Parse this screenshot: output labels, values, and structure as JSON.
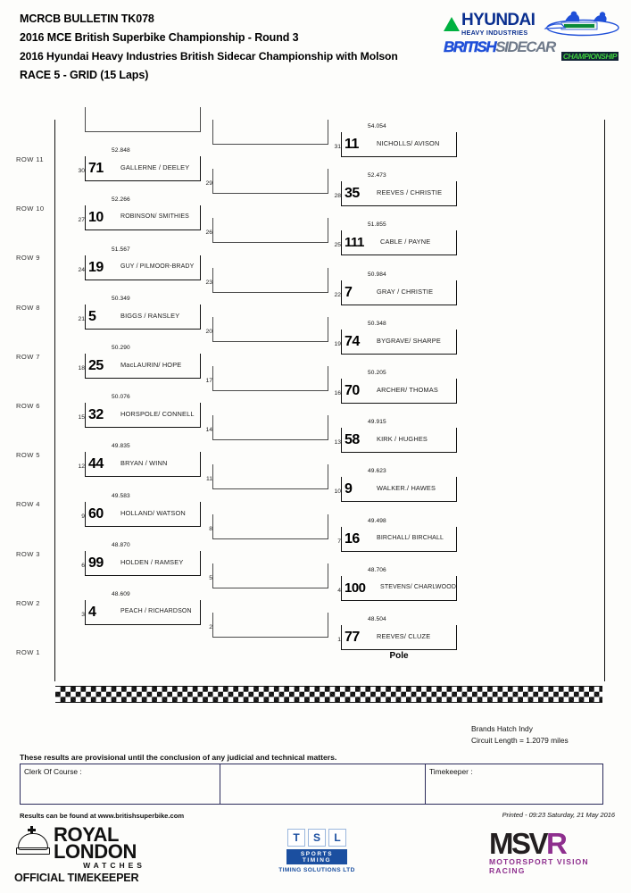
{
  "header": {
    "bulletin": "MCRCB BULLETIN TK078",
    "championship": "2016 MCE British Superbike Championship - Round 3",
    "series": "2016 Hyundai Heavy Industries British Sidecar Championship with Molson",
    "race": "RACE 5 - GRID (15 Laps)"
  },
  "logo": {
    "hyundai_main": "HYUNDAI",
    "hyundai_sub": "HEAVY INDUSTRIES",
    "british": "BRITISH",
    "sidecar": "SIDECAR",
    "championship": "CHAMPIONSHIP"
  },
  "grid": {
    "pole_label": "Pole",
    "rows": [
      {
        "label": "ROW 11",
        "slots": [
          {
            "column": "left",
            "pos": "",
            "time": "",
            "number": "",
            "name": ""
          },
          {
            "column": "middle",
            "pos": "",
            "time": "",
            "number": "",
            "name": ""
          },
          {
            "column": "right",
            "pos": "31",
            "time": "54.054",
            "number": "11",
            "name": "NICHOLLS/ AVISON"
          }
        ]
      },
      {
        "label": "ROW 10",
        "slots": [
          {
            "column": "left",
            "pos": "30",
            "time": "52.848",
            "number": "71",
            "name": "GALLERNE / DEELEY"
          },
          {
            "column": "middle",
            "pos": "29",
            "time": "",
            "number": "",
            "name": ""
          },
          {
            "column": "right",
            "pos": "28",
            "time": "52.473",
            "number": "35",
            "name": "REEVES / CHRISTIE"
          }
        ]
      },
      {
        "label": "ROW 9",
        "slots": [
          {
            "column": "left",
            "pos": "27",
            "time": "52.266",
            "number": "10",
            "name": "ROBINSON/ SMITHIES"
          },
          {
            "column": "middle",
            "pos": "26",
            "time": "",
            "number": "",
            "name": ""
          },
          {
            "column": "right",
            "pos": "25",
            "time": "51.855",
            "number": "111",
            "name": "CABLE / PAYNE"
          }
        ]
      },
      {
        "label": "ROW 8",
        "slots": [
          {
            "column": "left",
            "pos": "24",
            "time": "51.567",
            "number": "19",
            "name": "GUY / PILMOOR-BRADY"
          },
          {
            "column": "middle",
            "pos": "23",
            "time": "",
            "number": "",
            "name": ""
          },
          {
            "column": "right",
            "pos": "22",
            "time": "50.984",
            "number": "7",
            "name": "GRAY / CHRISTIE"
          }
        ]
      },
      {
        "label": "ROW 7",
        "slots": [
          {
            "column": "left",
            "pos": "21",
            "time": "50.349",
            "number": "5",
            "name": "BIGGS / RANSLEY"
          },
          {
            "column": "middle",
            "pos": "20",
            "time": "",
            "number": "",
            "name": ""
          },
          {
            "column": "right",
            "pos": "19",
            "time": "50.348",
            "number": "74",
            "name": "BYGRAVE/ SHARPE"
          }
        ]
      },
      {
        "label": "ROW 6",
        "slots": [
          {
            "column": "left",
            "pos": "18",
            "time": "50.290",
            "number": "25",
            "name": "MacLAURIN/ HOPE"
          },
          {
            "column": "middle",
            "pos": "17",
            "time": "",
            "number": "",
            "name": ""
          },
          {
            "column": "right",
            "pos": "16",
            "time": "50.205",
            "number": "70",
            "name": "ARCHER/ THOMAS"
          }
        ]
      },
      {
        "label": "ROW 5",
        "slots": [
          {
            "column": "left",
            "pos": "15",
            "time": "50.076",
            "number": "32",
            "name": "HORSPOLE/ CONNELL"
          },
          {
            "column": "middle",
            "pos": "14",
            "time": "",
            "number": "",
            "name": ""
          },
          {
            "column": "right",
            "pos": "13",
            "time": "49.915",
            "number": "58",
            "name": "KIRK / HUGHES"
          }
        ]
      },
      {
        "label": "ROW 4",
        "slots": [
          {
            "column": "left",
            "pos": "12",
            "time": "49.835",
            "number": "44",
            "name": "BRYAN / WINN"
          },
          {
            "column": "middle",
            "pos": "11",
            "time": "",
            "number": "",
            "name": ""
          },
          {
            "column": "right",
            "pos": "10",
            "time": "49.623",
            "number": "9",
            "name": "WALKER./ HAWES"
          }
        ]
      },
      {
        "label": "ROW 3",
        "slots": [
          {
            "column": "left",
            "pos": "9",
            "time": "49.583",
            "number": "60",
            "name": "HOLLAND/ WATSON"
          },
          {
            "column": "middle",
            "pos": "8",
            "time": "",
            "number": "",
            "name": ""
          },
          {
            "column": "right",
            "pos": "7",
            "time": "49.498",
            "number": "16",
            "name": "BIRCHALL/ BIRCHALL"
          }
        ]
      },
      {
        "label": "ROW 2",
        "slots": [
          {
            "column": "left",
            "pos": "6",
            "time": "48.870",
            "number": "99",
            "name": "HOLDEN / RAMSEY"
          },
          {
            "column": "middle",
            "pos": "5",
            "time": "",
            "number": "",
            "name": ""
          },
          {
            "column": "right",
            "pos": "4",
            "time": "48.706",
            "number": "100",
            "name": "STEVENS/ CHARLWOOD"
          }
        ]
      },
      {
        "label": "ROW 1",
        "slots": [
          {
            "column": "left",
            "pos": "3",
            "time": "48.609",
            "number": "4",
            "name": "PEACH / RICHARDSON"
          },
          {
            "column": "middle",
            "pos": "2",
            "time": "",
            "number": "",
            "name": ""
          },
          {
            "column": "right",
            "pos": "1",
            "time": "48.504",
            "number": "77",
            "name": "REEVES/ CLUZE",
            "pole": true
          }
        ]
      }
    ]
  },
  "circuit": {
    "name": "Brands Hatch Indy",
    "length": "Circuit Length = 1.2079 miles"
  },
  "provisional": "These results are provisional until the conclusion of any judicial and technical matters.",
  "signatures": {
    "clerk": "Clerk Of Course :",
    "middle": "",
    "timekeeper": "Timekeeper :"
  },
  "footer": {
    "results_url": "Results can be found at www.britishsuperbike.com",
    "printed": "Printed - 09:23 Saturday, 21 May 2016"
  },
  "sponsors": {
    "royal": "ROYAL",
    "london": "LONDON",
    "watches": "WATCHES",
    "official_timekeeper": "OFFICIAL TIMEKEEPER",
    "tsl_letters": [
      "T",
      "S",
      "L"
    ],
    "tsl_bar": "SPORTS TIMING",
    "tsl_sub": "TIMING SOLUTIONS LTD",
    "msvr_msv": "MSV",
    "msvr_r": "R",
    "msvr_sub": "MOTORSPORT VISION RACING"
  }
}
